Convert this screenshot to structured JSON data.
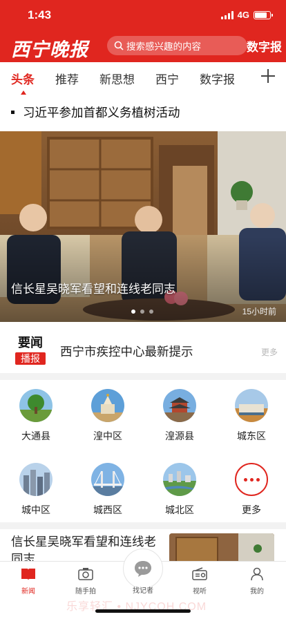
{
  "status_bar": {
    "time": "1:43",
    "network": "4G"
  },
  "header": {
    "logo": "西宁晚报",
    "search_placeholder": "搜索感兴趣的内容",
    "digital_label": "数字报"
  },
  "tabs": [
    {
      "label": "头条",
      "active": true
    },
    {
      "label": "推荐"
    },
    {
      "label": "新思想"
    },
    {
      "label": "西宁"
    },
    {
      "label": "数字报"
    }
  ],
  "headline": "习近平参加首都义务植树活动",
  "carousel": {
    "title": "信长星吴晓军看望和连线老同志",
    "time": "15小时前",
    "active_index": 0,
    "count": 3
  },
  "news_flash": {
    "label_top": "要闻",
    "label_bottom": "播报",
    "text": "西宁市疾控中心最新提示",
    "more": "更多"
  },
  "districts": [
    {
      "label": "大通县",
      "icon": "tree-photo"
    },
    {
      "label": "湟中区",
      "icon": "pagoda-photo"
    },
    {
      "label": "湟源县",
      "icon": "gate-tower-photo"
    },
    {
      "label": "城东区",
      "icon": "building-photo"
    },
    {
      "label": "城中区",
      "icon": "city-skyline-photo"
    },
    {
      "label": "城西区",
      "icon": "bridge-photo"
    },
    {
      "label": "城北区",
      "icon": "park-photo"
    },
    {
      "label": "更多",
      "icon": "more-icon"
    }
  ],
  "article": {
    "title": "信长星吴晓军看望和连线老同志"
  },
  "tabbar": [
    {
      "label": "新闻",
      "icon": "news-book-icon",
      "active": true
    },
    {
      "label": "随手拍",
      "icon": "camera-icon"
    },
    {
      "label": "找记者",
      "icon": "chat-bubble-icon"
    },
    {
      "label": "视听",
      "icon": "radio-icon"
    },
    {
      "label": "我的",
      "icon": "user-icon"
    }
  ],
  "watermark": "乐享轻汇 • NJYCOH.COM",
  "colors": {
    "brand_red": "#e0261f",
    "separator": "#f2f2f2"
  }
}
